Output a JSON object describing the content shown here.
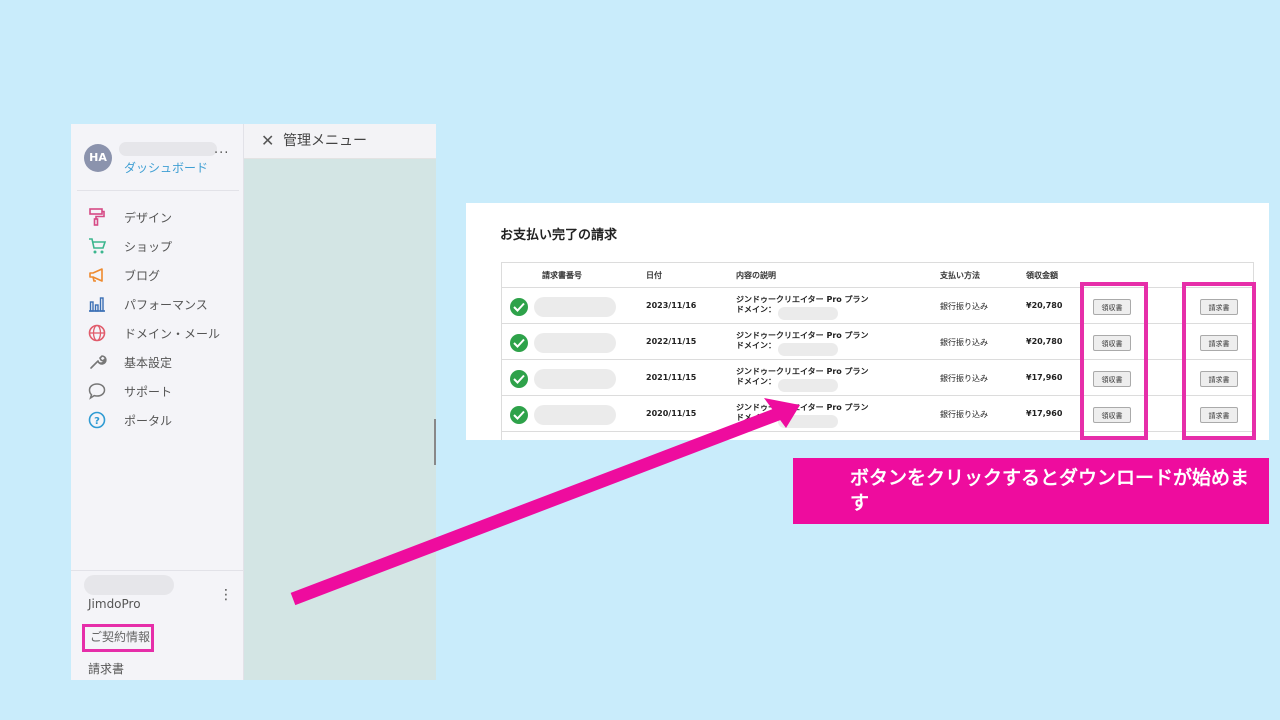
{
  "admin": {
    "avatar_initials": "HA",
    "user_menu": "...",
    "dashboard_link": "ダッシュボード",
    "nav_items": [
      {
        "label": "デザイン",
        "icon": "paint-roller-icon",
        "color": "#d64a86"
      },
      {
        "label": "ショップ",
        "icon": "cart-icon",
        "color": "#3bb68e"
      },
      {
        "label": "ブログ",
        "icon": "megaphone-icon",
        "color": "#ee8a2e"
      },
      {
        "label": "パフォーマンス",
        "icon": "bar-chart-icon",
        "color": "#3a6fb5"
      },
      {
        "label": "ドメイン・メール",
        "icon": "globe-icon",
        "color": "#e15b6b"
      },
      {
        "label": "基本設定",
        "icon": "wrench-icon",
        "color": "#777777"
      },
      {
        "label": "サポート",
        "icon": "speech-bubble-icon",
        "color": "#777777"
      },
      {
        "label": "ポータル",
        "icon": "help-circle-icon",
        "color": "#2f9bd3"
      }
    ],
    "plan_name": "JimdoPro",
    "plan_menu": "⋮",
    "contract_link": "ご契約情報",
    "invoice_link": "請求書",
    "menu_close": "✕",
    "menu_title": "管理メニュー"
  },
  "invoices": {
    "heading": "お支払い完了の請求",
    "columns": [
      "請求書番号",
      "日付",
      "内容の説明",
      "支払い方法",
      "領収金額"
    ],
    "rows": [
      {
        "date": "2023/11/16",
        "desc1": "ジンドゥークリエイター Pro プラン",
        "desc2": "ドメイン：",
        "method": "銀行振り込み",
        "amount": "¥20,780",
        "receipt": "領収書",
        "invoice": "請求書"
      },
      {
        "date": "2022/11/15",
        "desc1": "ジンドゥークリエイター Pro プラン",
        "desc2": "ドメイン：",
        "method": "銀行振り込み",
        "amount": "¥20,780",
        "receipt": "領収書",
        "invoice": "請求書"
      },
      {
        "date": "2021/11/15",
        "desc1": "ジンドゥークリエイター Pro プラン",
        "desc2": "ドメイン：",
        "method": "銀行振り込み",
        "amount": "¥17,960",
        "receipt": "領収書",
        "invoice": "請求書"
      },
      {
        "date": "2020/11/15",
        "desc1": "ジンドゥークリエイター Pro プラン",
        "desc2": "ドメイン：",
        "method": "銀行振り込み",
        "amount": "¥17,960",
        "receipt": "領収書",
        "invoice": "請求書"
      }
    ]
  },
  "callout": {
    "text": "ボタンをクリックするとダウンロードが始めます"
  },
  "colors": {
    "background": "#c9ecfb",
    "highlight": "#e62ea9",
    "callout": "#ee0c9e",
    "accent_link": "#3f9fd3",
    "check": "#2ea24a"
  }
}
